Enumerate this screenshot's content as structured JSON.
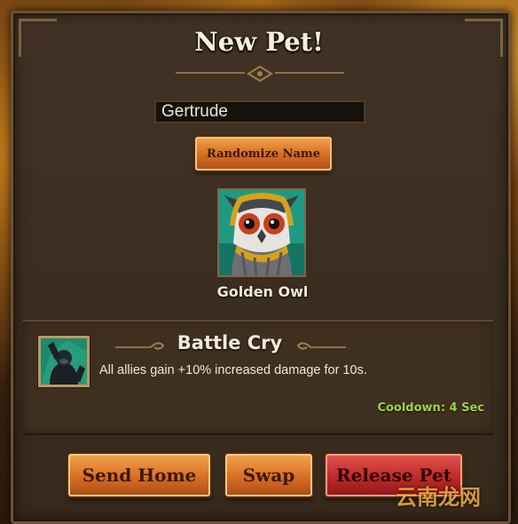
{
  "dialog": {
    "title": "New Pet!"
  },
  "name_field": {
    "value": "Gertrude"
  },
  "buttons": {
    "randomize": "Randomize Name",
    "send_home": "Send Home",
    "swap": "Swap",
    "release": "Release Pet"
  },
  "pet": {
    "name": "Golden Owl",
    "portrait_icon": "owl-icon"
  },
  "ability": {
    "title": "Battle Cry",
    "description": "All allies gain +10% increased damage for 10s.",
    "cooldown": "Cooldown: 4 Sec",
    "icon": "gorilla-icon"
  },
  "watermark": {
    "text": "云南龙网"
  },
  "colors": {
    "accent_orange": "#d86f23",
    "release_red": "#bf2b29",
    "cooldown_green": "#9fd24a"
  }
}
